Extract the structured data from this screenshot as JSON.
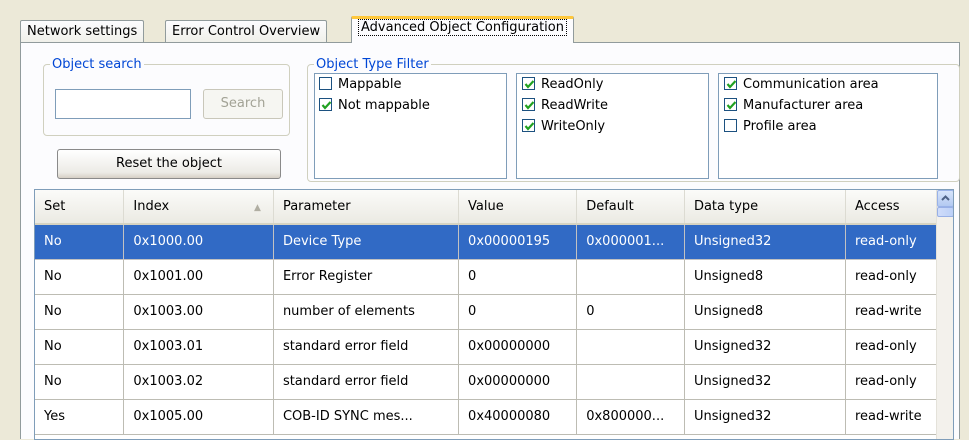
{
  "tabs": [
    {
      "label": "Network settings",
      "active": false
    },
    {
      "label": "Error Control Overview",
      "active": false
    },
    {
      "label": "Advanced Object Configuration",
      "active": true
    }
  ],
  "object_search": {
    "legend": "Object search",
    "input_value": "",
    "search_label": "Search",
    "reset_label": "Reset the object"
  },
  "type_filter": {
    "legend": "Object Type Filter",
    "mapping": [
      {
        "label": "Mappable",
        "checked": false
      },
      {
        "label": "Not mappable",
        "checked": true
      }
    ],
    "access": [
      {
        "label": "ReadOnly",
        "checked": true
      },
      {
        "label": "ReadWrite",
        "checked": true
      },
      {
        "label": "WriteOnly",
        "checked": true
      }
    ],
    "area": [
      {
        "label": "Communication area",
        "checked": true
      },
      {
        "label": "Manufacturer area",
        "checked": true
      },
      {
        "label": "Profile area",
        "checked": false
      }
    ]
  },
  "table": {
    "columns": [
      "Set",
      "Index",
      "Parameter",
      "Value",
      "Default",
      "Data type",
      "Access"
    ],
    "sort_column": "Index",
    "rows": [
      {
        "set": "No",
        "index": "0x1000.00",
        "parameter": "Device Type",
        "value": "0x00000195",
        "default": "0x000001...",
        "datatype": "Unsigned32",
        "access": "read-only",
        "selected": true
      },
      {
        "set": "No",
        "index": "0x1001.00",
        "parameter": "Error Register",
        "value": "0",
        "default": "",
        "datatype": "Unsigned8",
        "access": "read-only",
        "selected": false
      },
      {
        "set": "No",
        "index": "0x1003.00",
        "parameter": "number of elements",
        "value": "0",
        "default": "0",
        "datatype": "Unsigned8",
        "access": "read-write",
        "selected": false
      },
      {
        "set": "No",
        "index": "0x1003.01",
        "parameter": "standard error field",
        "value": "0x00000000",
        "default": "",
        "datatype": "Unsigned32",
        "access": "read-only",
        "selected": false
      },
      {
        "set": "No",
        "index": "0x1003.02",
        "parameter": "standard error field",
        "value": "0x00000000",
        "default": "",
        "datatype": "Unsigned32",
        "access": "read-only",
        "selected": false
      },
      {
        "set": "Yes",
        "index": "0x1005.00",
        "parameter": "COB-ID SYNC mes...",
        "value": "0x40000080",
        "default": "0x800000...",
        "datatype": "Unsigned32",
        "access": "read-write",
        "selected": false
      }
    ]
  },
  "icons": {
    "checkmark": "checkmark-icon",
    "sort": "sort-ascending-icon",
    "scroll_up": "scroll-up-arrow-icon"
  },
  "colors": {
    "selection": "#316ac5",
    "legend_text": "#0046d5",
    "active_tab_accent": "#ffc83c",
    "check": "#21a121"
  }
}
